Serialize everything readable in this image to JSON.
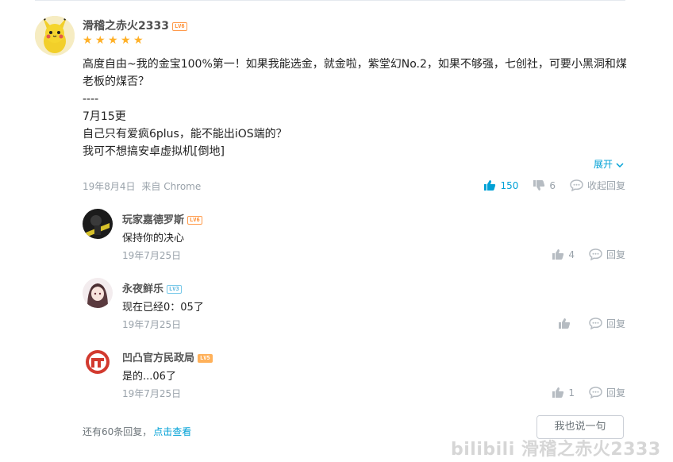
{
  "main_comment": {
    "username": "滑稽之赤火2333",
    "level": "LV6",
    "rating_stars": 5,
    "lines": [
      "高度自由~我的金宝100%第一！如果我能选金，就金啦，紫堂幻No.2，如果不够强，七创社，可要小黑洞和煤",
      "老板的煤否？",
      "----",
      "7月15更",
      "自己只有爱疯6plus，能不能出iOS端的？",
      "我可不想搞安卓虚拟机[倒地]"
    ],
    "expand_label": "展开",
    "date": "19年8月4日",
    "source": "来自 Chrome",
    "likes": "150",
    "dislikes": "6",
    "collapse_reply_label": "收起回复"
  },
  "replies": [
    {
      "username": "玩家嘉德罗斯",
      "level": "LV6",
      "text": "保持你的决心",
      "date": "19年7月25日",
      "likes": "4",
      "reply_label": "回复"
    },
    {
      "username": "永夜鲜乐",
      "level": "LV3",
      "text": "现在已经0：05了",
      "date": "19年7月25日",
      "likes": "",
      "reply_label": "回复"
    },
    {
      "username": "凹凸官方民政局",
      "level": "LV5",
      "text": "是的...06了",
      "date": "19年7月25日",
      "likes": "1",
      "reply_label": "回复"
    }
  ],
  "footer": {
    "more_text": "还有60条回复，",
    "more_link": "点击查看",
    "reply_button": "我也说一句"
  },
  "watermark": "bilibili 滑稽之赤火2333",
  "colors": {
    "link": "#00a1d6",
    "meta": "#99a2aa",
    "star": "#ffb027",
    "badge": "#ff8c2e"
  }
}
